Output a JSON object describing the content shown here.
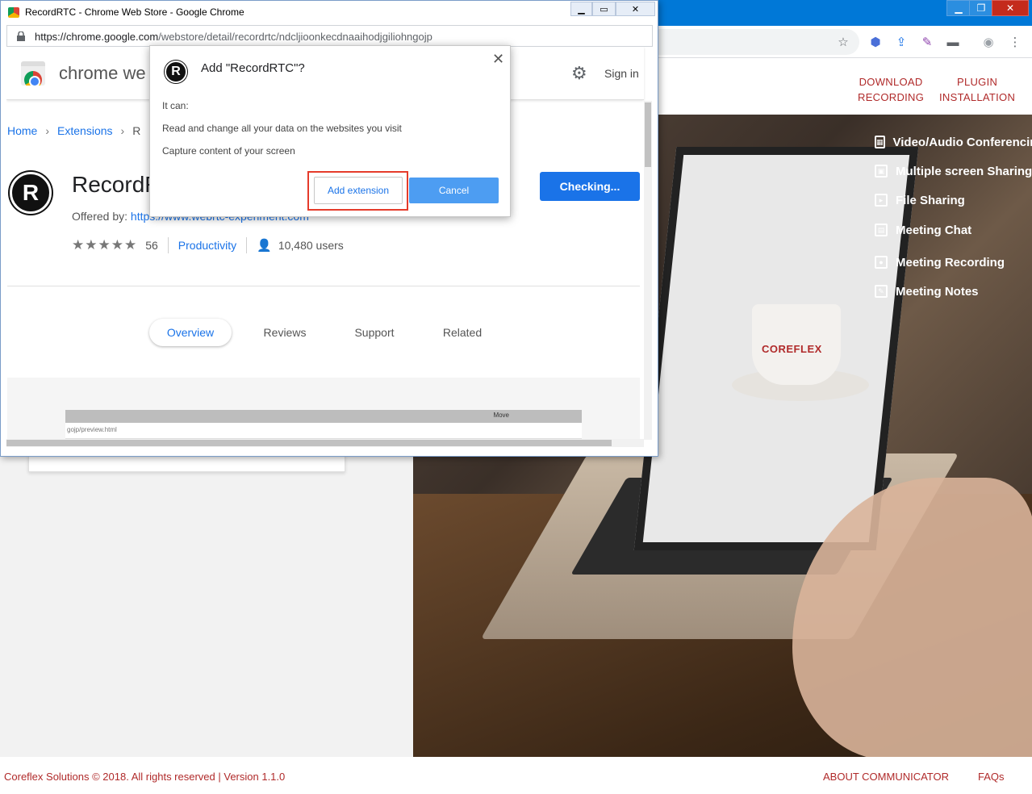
{
  "popup": {
    "title": "RecordRTC - Chrome Web Store - Google Chrome",
    "url_prefix": "https://chrome.google.com",
    "url_path": "/webstore/detail/recordrtc/ndcljioonkecdnaaihodjgiliohngojp",
    "controls": {
      "minimize": "▁",
      "maximize": "▭",
      "close": "✕"
    }
  },
  "webstore": {
    "brand": "chrome we",
    "sign_in": "Sign in",
    "breadcrumb": [
      "Home",
      "Extensions",
      "R"
    ],
    "extension_name": "RecordR",
    "offered_by_label": "Offered by: ",
    "offered_by_link": "https://www.webrtc-experiment.com",
    "rating_stars": "★★★★★",
    "rating_count": "56",
    "category": "Productivity",
    "users": "10,480 users",
    "install_button": "Checking...",
    "tabs": [
      "Overview",
      "Reviews",
      "Support",
      "Related"
    ],
    "preview_window_text": "Move",
    "preview_url": "gojp/preview.html"
  },
  "dialog": {
    "title": "Add \"RecordRTC\"?",
    "it_can": "It can:",
    "permissions": [
      "Read and change all your data on the websites you visit",
      "Capture content of your screen"
    ],
    "add_button": "Add extension",
    "cancel_button": "Cancel",
    "close": "✕",
    "icon_letter": "R"
  },
  "background": {
    "window_controls": {
      "minimize": "▁",
      "maximize": "❐",
      "close": "✕"
    },
    "nav": [
      "DOWNLOAD RECORDING",
      "PLUGIN INSTALLATION"
    ],
    "nav_lines": [
      [
        "DOWNLOAD",
        "RECORDING"
      ],
      [
        "PLUGIN",
        "INSTALLATION"
      ]
    ],
    "features": [
      "Video/Audio Conferencing",
      "Multiple screen Sharing",
      "File Sharing",
      "Meeting Chat",
      "Meeting Recording",
      "Meeting Notes"
    ],
    "mug_logo": "COREFLEX",
    "footer_copyright": "Coreflex Solutions © 2018. All rights reserved | Version 1.1.0",
    "footer_links": [
      "ABOUT COMMUNICATOR",
      "FAQs"
    ]
  },
  "colors": {
    "accent_blue": "#1a73e8",
    "brand_red": "#b02a2a",
    "highlight_red": "#e53b2b",
    "titlebar_blue": "#0078d7"
  }
}
